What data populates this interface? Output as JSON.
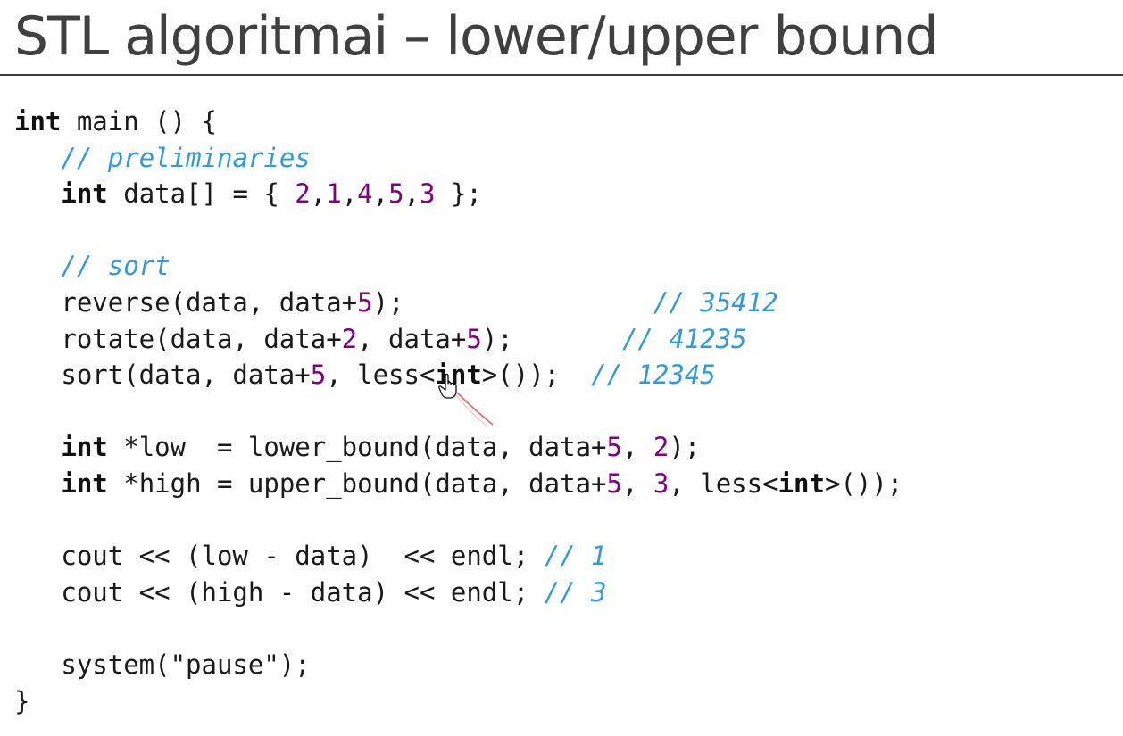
{
  "slide": {
    "title": "STL algoritmai – lower/upper bound"
  },
  "code": {
    "lines": [
      [
        {
          "t": "int",
          "c": "kw"
        },
        {
          "t": " main () {",
          "c": "p"
        }
      ],
      [
        {
          "t": "   ",
          "c": "p"
        },
        {
          "t": "// preliminaries",
          "c": "cm"
        }
      ],
      [
        {
          "t": "   ",
          "c": "p"
        },
        {
          "t": "int",
          "c": "kw"
        },
        {
          "t": " data[] = { ",
          "c": "p"
        },
        {
          "t": "2",
          "c": "num"
        },
        {
          "t": ",",
          "c": "p"
        },
        {
          "t": "1",
          "c": "num"
        },
        {
          "t": ",",
          "c": "p"
        },
        {
          "t": "4",
          "c": "num"
        },
        {
          "t": ",",
          "c": "p"
        },
        {
          "t": "5",
          "c": "num"
        },
        {
          "t": ",",
          "c": "p"
        },
        {
          "t": "3",
          "c": "num"
        },
        {
          "t": " };",
          "c": "p"
        }
      ],
      [],
      [
        {
          "t": "   ",
          "c": "p"
        },
        {
          "t": "// sort",
          "c": "cm"
        }
      ],
      [
        {
          "t": "   reverse(data, data+",
          "c": "p"
        },
        {
          "t": "5",
          "c": "num"
        },
        {
          "t": ");                ",
          "c": "p"
        },
        {
          "t": "// 35412",
          "c": "cm"
        }
      ],
      [
        {
          "t": "   rotate(data, data+",
          "c": "p"
        },
        {
          "t": "2",
          "c": "num"
        },
        {
          "t": ", data+",
          "c": "p"
        },
        {
          "t": "5",
          "c": "num"
        },
        {
          "t": ");       ",
          "c": "p"
        },
        {
          "t": "// 41235",
          "c": "cm"
        }
      ],
      [
        {
          "t": "   sort(data, data+",
          "c": "p"
        },
        {
          "t": "5",
          "c": "num"
        },
        {
          "t": ", less<",
          "c": "p"
        },
        {
          "t": "int",
          "c": "kw"
        },
        {
          "t": ">());  ",
          "c": "p"
        },
        {
          "t": "// 12345",
          "c": "cm"
        }
      ],
      [],
      [
        {
          "t": "   ",
          "c": "p"
        },
        {
          "t": "int",
          "c": "kw"
        },
        {
          "t": " *low  = lower_bound(data, data+",
          "c": "p"
        },
        {
          "t": "5",
          "c": "num"
        },
        {
          "t": ", ",
          "c": "p"
        },
        {
          "t": "2",
          "c": "num"
        },
        {
          "t": ");",
          "c": "p"
        }
      ],
      [
        {
          "t": "   ",
          "c": "p"
        },
        {
          "t": "int",
          "c": "kw"
        },
        {
          "t": " *high = upper_bound(data, data+",
          "c": "p"
        },
        {
          "t": "5",
          "c": "num"
        },
        {
          "t": ", ",
          "c": "p"
        },
        {
          "t": "3",
          "c": "num"
        },
        {
          "t": ", less<",
          "c": "p"
        },
        {
          "t": "int",
          "c": "kw"
        },
        {
          "t": ">());",
          "c": "p"
        }
      ],
      [],
      [
        {
          "t": "   cout << (low - data)  << endl; ",
          "c": "p"
        },
        {
          "t": "// 1",
          "c": "cm"
        }
      ],
      [
        {
          "t": "   cout << (high - data) << endl; ",
          "c": "p"
        },
        {
          "t": "// 3",
          "c": "cm"
        }
      ],
      [],
      [
        {
          "t": "   system(\"pause\");",
          "c": "p"
        }
      ],
      [
        {
          "t": "}",
          "c": "p"
        }
      ]
    ]
  },
  "overlay": {
    "cursor_icon": "hand-pointer-icon",
    "pen_mark": "red-pen-stroke",
    "colors": {
      "pen": "#e03030",
      "keyword": "#111111",
      "number": "#800080",
      "comment": "#3399dd",
      "title": "#404040"
    }
  }
}
